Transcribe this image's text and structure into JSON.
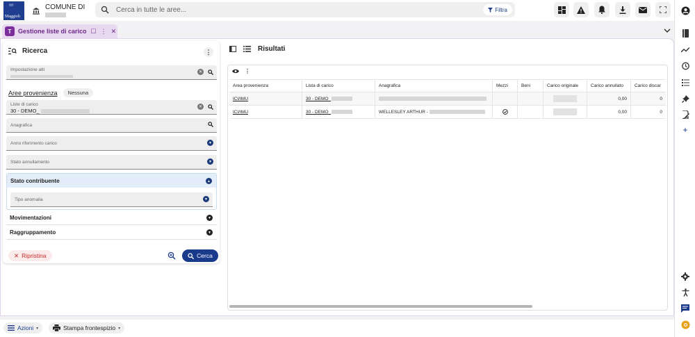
{
  "header": {
    "comune_label": "COMUNE DI",
    "search_placeholder": "Cerca in tutte le aree...",
    "filter_label": "Filtra"
  },
  "tab": {
    "label": "Gestione liste di carico",
    "icon_letter": "T"
  },
  "search_panel": {
    "title": "Ricerca",
    "fields": {
      "impostazione": "Impostazione atti",
      "lista_label": "Liste di carico",
      "lista_value": "30 - DEMO_",
      "anagrafica": "Anagrafica",
      "anno": "Anno riferimento carico",
      "stato_annullamento": "Stato annullamento",
      "tipo_anomalia": "Tipo anomalia"
    },
    "aree_label": "Aree provenienza",
    "aree_chip": "Nessuna",
    "sections": {
      "stato_contribuente": "Stato contribuente",
      "movimentazioni": "Movimentazioni",
      "raggruppamento": "Raggruppamento"
    },
    "reset_label": "Ripristina",
    "search_label": "Cerca"
  },
  "results": {
    "title": "Risultati",
    "columns": [
      "Area provenienza",
      "Lista di carico",
      "Anagrafica",
      "Mezzi",
      "Beni",
      "Carico originale",
      "Carico annullato",
      "Carico discar"
    ],
    "rows": [
      {
        "area": "ICI/IMU",
        "lista": "30 - DEMO_",
        "anagrafica": "",
        "mezzi": "",
        "beni": "",
        "originale": "",
        "annullato": "0,00",
        "discar": "0"
      },
      {
        "area": "ICI/IMU",
        "lista": "30 - DEMO_",
        "anagrafica": "WELLESLEY ARTHUR -",
        "mezzi": "check",
        "beni": "",
        "originale": "",
        "annullato": "0,00",
        "discar": "0"
      }
    ]
  },
  "footer": {
    "azioni": "Azioni",
    "stampa": "Stampa frontespizio"
  },
  "colors": {
    "primary": "#1a3a8c",
    "tab_bg": "#e9d9f0",
    "tab_accent": "#7b2e9c",
    "danger": "#c62828"
  }
}
